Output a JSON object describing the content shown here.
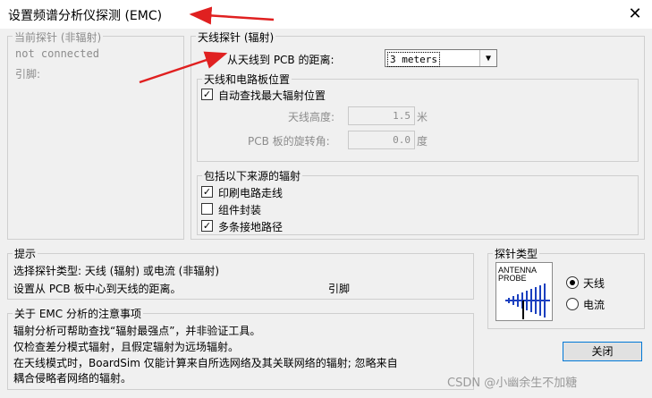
{
  "window": {
    "title": "设置频谱分析仪探测 (EMC)"
  },
  "icons": {
    "close": "close-icon",
    "check": "✓",
    "dropdown": "chevron-down-icon"
  },
  "current_probe": {
    "label": "当前探针 (非辐射)",
    "status": "not connected",
    "pin_label": "引脚:"
  },
  "antenna_probe": {
    "label": "天线探针 (辐射)",
    "distance_label": "从天线到 PCB 的距离:",
    "distance_value": "3 meters",
    "position_group": {
      "label": "天线和电路板位置",
      "auto_find_label": "自动查找最大辐射位置",
      "auto_find_checked": true,
      "height_label": "天线高度:",
      "height_value": "1.5",
      "height_unit": "米",
      "rotation_label": "PCB 板的旋转角:",
      "rotation_value": "0.0",
      "rotation_unit": "度"
    },
    "sources_group": {
      "label": "包括以下来源的辐射",
      "items": [
        {
          "label": "印刷电路走线",
          "checked": true
        },
        {
          "label": "组件封装",
          "checked": false
        },
        {
          "label": "多条接地路径",
          "checked": true
        }
      ]
    }
  },
  "hint": {
    "label": "提示",
    "line1": "选择探针类型: 天线 (辐射) 或电流 (非辐射)",
    "line2": "设置从 PCB 板中心到天线的距离。",
    "line2_right": "引脚"
  },
  "notes": {
    "label": "关于 EMC 分析的注意事项",
    "lines": [
      "辐射分析可帮助查找“辐射最强点”，并非验证工具。",
      "仅检查差分模式辐射，且假定辐射为远场辐射。",
      "在天线模式时，BoardSim 仅能计算来自所选网络及其关联网络的辐射; 忽略来自",
      "耦合侵略者网络的辐射。"
    ]
  },
  "probe_type": {
    "label": "探针类型",
    "image_text_line1": "ANTENNA",
    "image_text_line2": "PROBE",
    "options": [
      {
        "label": "天线",
        "selected": true
      },
      {
        "label": "电流",
        "selected": false
      }
    ]
  },
  "buttons": {
    "close_label": "关闭"
  },
  "watermark": "CSDN @小幽余生不加糖"
}
